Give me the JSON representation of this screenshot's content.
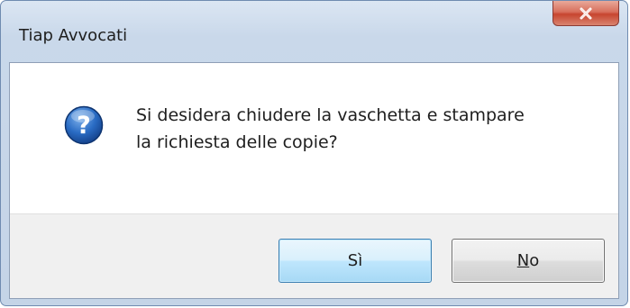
{
  "window": {
    "title": "Tiap Avvocati"
  },
  "dialog": {
    "icon": "question-icon",
    "message_line1": "Si desidera chiudere la vaschetta e stampare",
    "message_line2": "la richiesta delle copie?",
    "buttons": {
      "yes_label": "Sì",
      "no_label": "No",
      "no_accelerator": "N",
      "no_rest": "o"
    }
  },
  "colors": {
    "title_bar": "#c9d8ea",
    "close_button": "#c7452f",
    "default_button": "#bee6fd",
    "icon_blue": "#1f5fb4"
  }
}
